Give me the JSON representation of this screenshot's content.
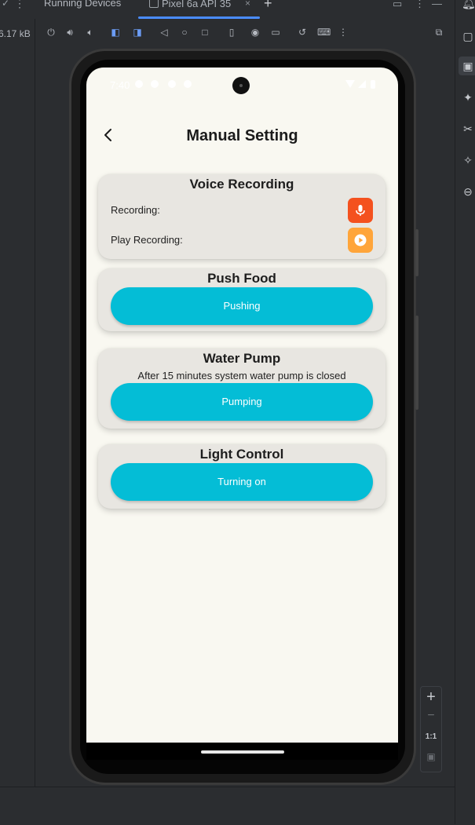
{
  "ide": {
    "left_size": "6.17 kB",
    "tabs": {
      "running_devices": "Running Devices",
      "device": "Pixel 6a API 35"
    },
    "tab_close": "×",
    "tab_add": "+",
    "zoom": {
      "plus": "+",
      "minus": "−",
      "ratio": "1:1"
    }
  },
  "phone": {
    "status_time": "7:40",
    "header": {
      "title": "Manual Setting"
    },
    "voice_recording": {
      "title": "Voice Recording",
      "recording_label": "Recording:",
      "play_label": "Play Recording:",
      "mic_color": "#f4511e",
      "play_color": "#ffa53a"
    },
    "push_food": {
      "title": "Push Food",
      "button": "Pushing"
    },
    "water_pump": {
      "title": "Water Pump",
      "subtitle": "After 15 minutes system water pump is closed",
      "button": "Pumping"
    },
    "light_control": {
      "title": "Light Control",
      "button": "Turning on"
    },
    "accent": "#04bdd6"
  }
}
